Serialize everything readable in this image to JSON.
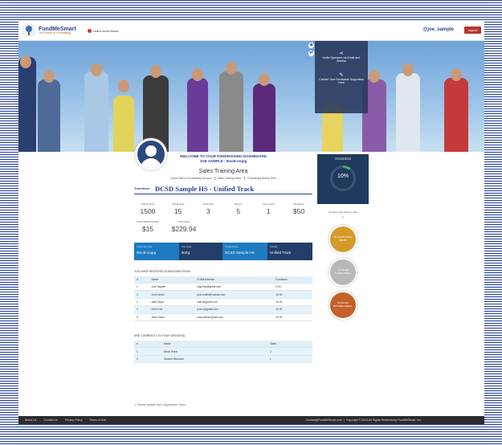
{
  "header": {
    "logo_title": "FundMeSmart",
    "logo_subtitle": "The Future of Fundraising",
    "learn_link": "Learn more About",
    "user": "@joe_sample",
    "logout": "logout"
  },
  "hero": {
    "panel_top": "Invite Sponsors via Email and Sidebar",
    "panel_bottom": "Contact Your Fundraiser Supporters Here"
  },
  "welcome": {
    "line1": "WELCOME TO YOUR FUNDRAISING DASHBOARD",
    "line2": "JOE SAMPLE - 5mo8-ooqqj"
  },
  "sales": {
    "title": "Sales Training Area",
    "links": [
      "Quick Start to Fundraising Success",
      "Sales Training Video",
      "Fundraising Before Here"
    ]
  },
  "campaign": {
    "logo_text": "Transform",
    "name": "DCSD Sample HS - Unified Track"
  },
  "stats": [
    {
      "label": "Activity Goal",
      "value": "1500"
    },
    {
      "label": "Actual Goal",
      "value": "15"
    },
    {
      "label": "Referrals",
      "value": "3"
    },
    {
      "label": "Donors",
      "value": "5"
    },
    {
      "label": "Items Sold",
      "value": "1"
    },
    {
      "label": "Donations",
      "value": "$50"
    }
  ],
  "stats2": [
    {
      "label": "Funds Raised Status",
      "value": "$15"
    },
    {
      "label": "Total Sales",
      "value": "$229.94"
    }
  ],
  "infobar": [
    {
      "key": "Personal code",
      "value": "5mo8-ooqqj",
      "color": "#1d7bbf"
    },
    {
      "key": "Org code",
      "value": "8ctrg",
      "color": "#233e6a"
    },
    {
      "key": "Organization",
      "value": "DCSD Sample HS",
      "color": "#1d7bbf"
    },
    {
      "key": "Activity",
      "value": "Unified Track",
      "color": "#233e6a"
    }
  ],
  "donors_title": "YOU HAVE RECEIVED DONATIONS FROM",
  "donors": {
    "headers": [
      "#",
      "Name",
      "E-Mail Address",
      "Donations"
    ],
    "rows": [
      [
        "1",
        "Lisa Sappler",
        "dlap.test@gmail.com",
        "0.00"
      ],
      [
        "2",
        "John Smith",
        "john.smith@hotmail.com",
        "10.00"
      ],
      [
        "3",
        "Walt Taylor",
        "walt.t@gmail.com",
        "10.00"
      ],
      [
        "4",
        "John Doe",
        "john.s@gmail.com",
        "10.00"
      ],
      [
        "5",
        "Mary David",
        "mary.d@aol.gmail.com",
        "10.00"
      ]
    ]
  },
  "supporters_title": "ARE CURRENTLY IN YOUR GROUP(S)",
  "supporters": {
    "headers": [
      "#",
      "Name",
      "Sales"
    ],
    "rows": [
      [
        "1",
        "Steve Hilton",
        "2"
      ],
      [
        "2",
        "Samuel Woodard",
        "1"
      ]
    ]
  },
  "warning": "Please update your Organization Stats",
  "progress": {
    "label": "PROGRESS",
    "percent_text": "10%",
    "percent": 10
  },
  "medals": {
    "note": "Increase your sales to earn",
    "items": [
      {
        "label": "25 SALES GOLD MEDAL",
        "color": "#d49a2a"
      },
      {
        "label": "15 SALES SILVER MEDAL",
        "color": "#b8b8b8"
      },
      {
        "label": "10 SALES BRONZE MEDAL",
        "color": "#c4602a"
      }
    ]
  },
  "footer": {
    "links": [
      "About Us",
      "Contact Us",
      "Privacy Policy",
      "Terms of Use"
    ],
    "email": "Contact@FundMeSmart.com",
    "copyright": "Copyright © 2024 All Rights Reserved by FundMeSmart, Inc."
  }
}
